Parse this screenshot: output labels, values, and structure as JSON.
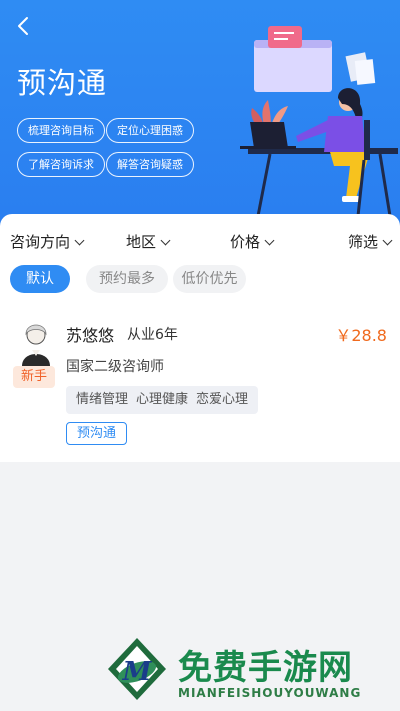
{
  "colors": {
    "primary": "#2f8cf3",
    "price": "#f06a1e",
    "badge": "#f0622a",
    "watermark": "#1a8a4d"
  },
  "header": {
    "back_icon": "chevron-left-icon",
    "title": "预沟通",
    "chips": [
      "梳理咨询目标",
      "定位心理困惑",
      "了解咨询诉求",
      "解答咨询疑惑"
    ]
  },
  "filters": {
    "items": [
      "咨询方向",
      "地区",
      "价格",
      "筛选"
    ],
    "caret_icon": "chevron-down-icon"
  },
  "sort": {
    "options": [
      "默认",
      "预约最多",
      "低价优先"
    ],
    "selected": "默认"
  },
  "consultant": {
    "name": "苏悠悠",
    "experience": "从业6年",
    "price": "￥28.8",
    "badge": "新手",
    "certification": "国家二级咨询师",
    "tags": [
      "情绪管理",
      "心理健康",
      "恋爱心理"
    ],
    "service": "预沟通"
  },
  "watermark": {
    "title": "免费手游网",
    "subtitle": "MIANFEISHOUYOUWANG",
    "logo_letter": "M"
  }
}
